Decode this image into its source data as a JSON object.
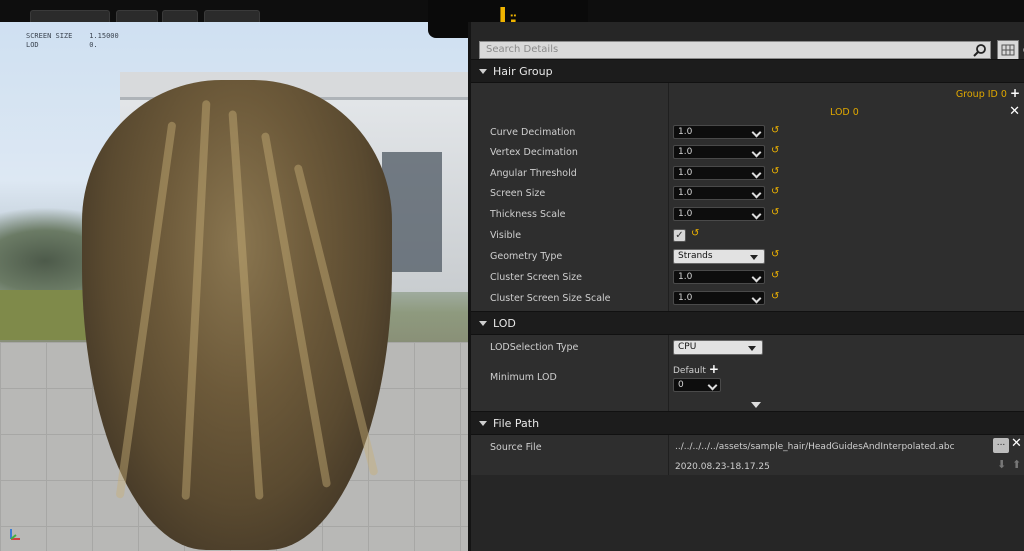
{
  "logo": {
    "text": "تا"
  },
  "viewport": {
    "stats": "SCREEN SIZE    1.15000\nLOD            0."
  },
  "details": {
    "search_placeholder": "Search Details",
    "sections": {
      "hair_group": {
        "title": "Hair Group",
        "group_id": "Group ID 0",
        "lod_label": "LOD 0",
        "rows": [
          {
            "label": "Curve Decimation",
            "value": "1.0"
          },
          {
            "label": "Vertex Decimation",
            "value": "1.0"
          },
          {
            "label": "Angular Threshold",
            "value": "1.0"
          },
          {
            "label": "Screen Size",
            "value": "1.0"
          },
          {
            "label": "Thickness Scale",
            "value": "1.0"
          }
        ],
        "visible_label": "Visible",
        "visible_checked": true,
        "geometry_type_label": "Geometry Type",
        "geometry_type_value": "Strands",
        "cluster_rows": [
          {
            "label": "Cluster Screen Size",
            "value": "1.0"
          },
          {
            "label": "Cluster Screen Size Scale",
            "value": "1.0"
          }
        ]
      },
      "lod": {
        "title": "LOD",
        "selection_label": "LODSelection Type",
        "selection_value": "CPU",
        "minimum_label": "Minimum LOD",
        "default_label": "Default",
        "minimum_value": "0"
      },
      "file_path": {
        "title": "File Path",
        "source_label": "Source File",
        "source_path": "../../../../../assets/sample_hair/HeadGuidesAndInterpolated.abc",
        "timestamp": "2020.08.23-18.17.25",
        "browse_label": "..."
      }
    }
  }
}
